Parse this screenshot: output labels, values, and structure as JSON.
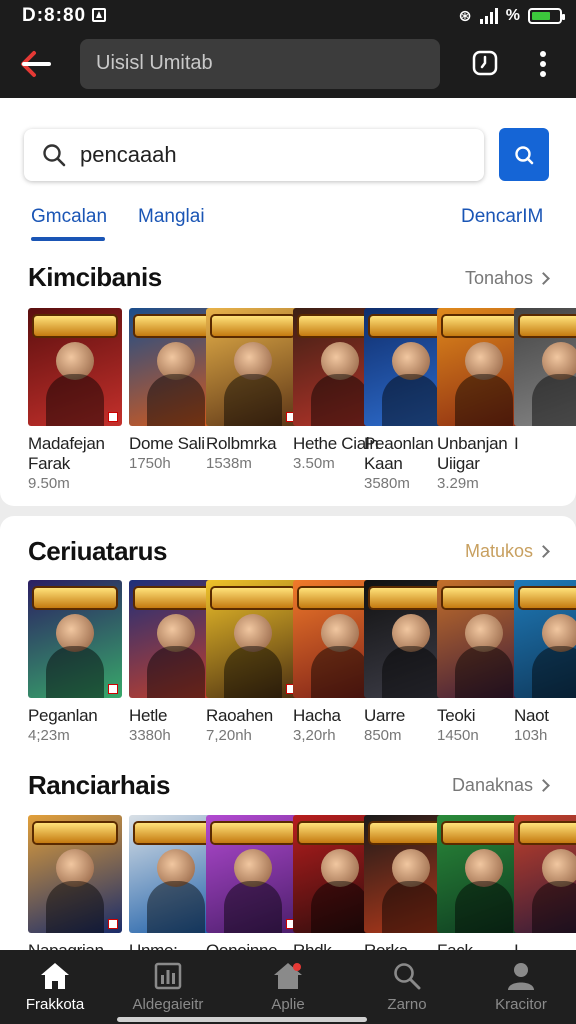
{
  "status_bar": {
    "time": "D:8:80",
    "battery_text": "%"
  },
  "app_bar": {
    "title": "Uisisl Umitab"
  },
  "search": {
    "value": "pencaaah"
  },
  "tabs": [
    {
      "label": "Gmcalan",
      "active": true
    },
    {
      "label": "Manglai",
      "active": false
    },
    {
      "label": "DencarIM",
      "active": false
    }
  ],
  "sections": [
    {
      "title": "Kimcibanis",
      "more_label": "Tonahos",
      "games": [
        {
          "name": "Madafejan Farak",
          "size": "9.50m",
          "colors": [
            "#5a0f0f",
            "#c4302b"
          ]
        },
        {
          "name": "Dome Sali",
          "size": "1750h",
          "colors": [
            "#1a4e8c",
            "#d85a1a"
          ]
        },
        {
          "name": "Rolbmrka",
          "size": "1538m",
          "colors": [
            "#e9b34a",
            "#5b3416"
          ]
        },
        {
          "name": "Hethe Cialn",
          "size": "3.50m",
          "colors": [
            "#3b1f14",
            "#b8342a"
          ]
        },
        {
          "name": "Peaonlan Kaan",
          "size": "3580m",
          "colors": [
            "#0f2d6b",
            "#2f6fd1"
          ]
        },
        {
          "name": "Unbanjan Uiigar",
          "size": "3.29m",
          "colors": [
            "#e08a1c",
            "#8a2a12"
          ]
        },
        {
          "name": "I",
          "size": "",
          "colors": [
            "#444444",
            "#888888"
          ]
        }
      ]
    },
    {
      "title": "Ceriuatarus",
      "more_label": "Matukos",
      "games": [
        {
          "name": "Peganlan",
          "size": "4;23m",
          "colors": [
            "#2b1e63",
            "#38a86a"
          ]
        },
        {
          "name": "Hetle",
          "size": "3380h",
          "colors": [
            "#1e2f7a",
            "#c4402a"
          ]
        },
        {
          "name": "Raoahen",
          "size": "7,20nh",
          "colors": [
            "#f0c22a",
            "#4a2f12"
          ]
        },
        {
          "name": "Hacha",
          "size": "3,20rh",
          "colors": [
            "#f07a2a",
            "#7a1e18"
          ]
        },
        {
          "name": "Uarre",
          "size": "850m",
          "colors": [
            "#111111",
            "#3f3f4a"
          ]
        },
        {
          "name": "Teoki",
          "size": "1450n",
          "colors": [
            "#c4702a",
            "#3b1a3a"
          ]
        },
        {
          "name": "Naot",
          "size": "103h",
          "colors": [
            "#1f7ab8",
            "#0e3556"
          ]
        }
      ]
    },
    {
      "title": "Ranciarhais",
      "more_label": "Danaknas",
      "games": [
        {
          "name": "Napagrian",
          "size": "",
          "colors": [
            "#e2a03a",
            "#1a2c6a"
          ]
        },
        {
          "name": "Unme:",
          "size": "",
          "colors": [
            "#d9e0e6",
            "#1c5ea8"
          ]
        },
        {
          "name": "Oonoinne",
          "size": "",
          "colors": [
            "#b24ad1",
            "#4a1e6a"
          ]
        },
        {
          "name": "Rhdk",
          "size": "",
          "colors": [
            "#b81e1e",
            "#2a0c0c"
          ]
        },
        {
          "name": "Rorka",
          "size": "",
          "colors": [
            "#1a1a1a",
            "#b83a1a"
          ]
        },
        {
          "name": "Fack",
          "size": "",
          "colors": [
            "#2a8a3a",
            "#0e3a20"
          ]
        },
        {
          "name": "I",
          "size": "",
          "colors": [
            "#c4402a",
            "#2a1a3a"
          ]
        }
      ]
    }
  ],
  "bottom_nav": [
    {
      "label": "Frakkota",
      "icon": "home-icon",
      "active": true
    },
    {
      "label": "Aldegaieitr",
      "icon": "chart-icon",
      "active": false
    },
    {
      "label": "Aplie",
      "icon": "store-icon",
      "active": false
    },
    {
      "label": "Zarno",
      "icon": "search-icon",
      "active": false
    },
    {
      "label": "Kracitor",
      "icon": "profile-icon",
      "active": false
    }
  ]
}
